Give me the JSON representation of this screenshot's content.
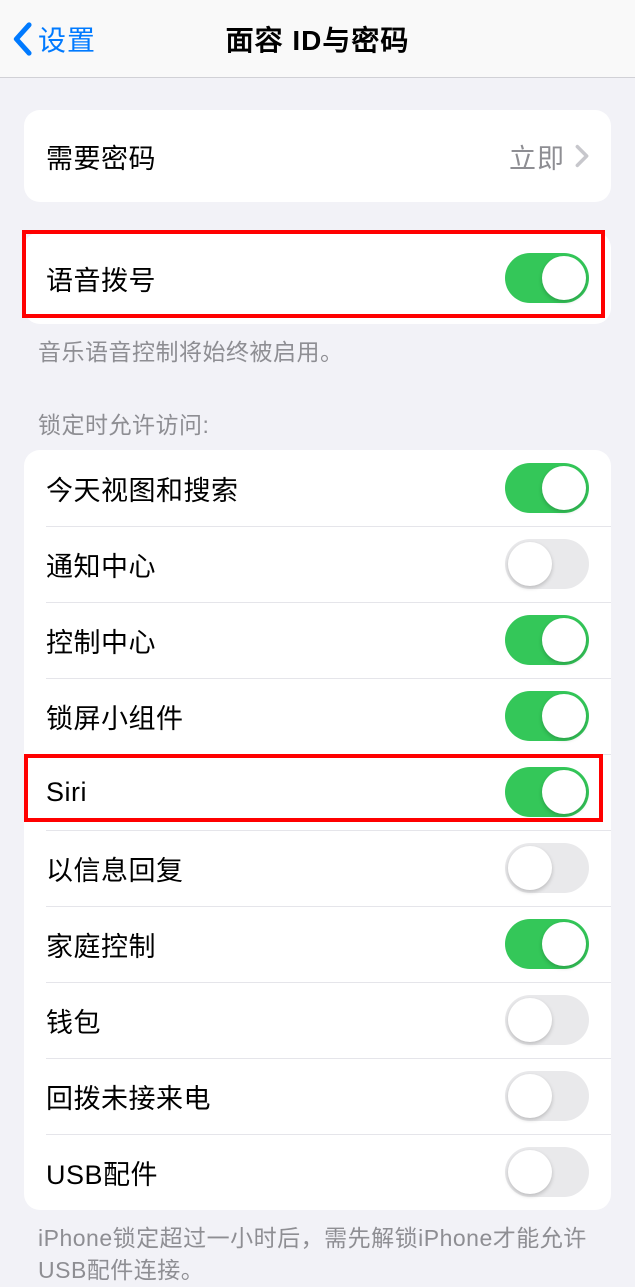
{
  "nav": {
    "back_label": "设置",
    "title": "面容 ID与密码"
  },
  "require_passcode": {
    "label": "需要密码",
    "value": "立即"
  },
  "voice_dial": {
    "label": "语音拨号",
    "on": true,
    "footer": "音乐语音控制将始终被启用。"
  },
  "lock_header": "锁定时允许访问:",
  "lock_items": [
    {
      "label": "今天视图和搜索",
      "on": true
    },
    {
      "label": "通知中心",
      "on": false
    },
    {
      "label": "控制中心",
      "on": true
    },
    {
      "label": "锁屏小组件",
      "on": true
    },
    {
      "label": "Siri",
      "on": true
    },
    {
      "label": "以信息回复",
      "on": false
    },
    {
      "label": "家庭控制",
      "on": true
    },
    {
      "label": "钱包",
      "on": false
    },
    {
      "label": "回拨未接来电",
      "on": false
    },
    {
      "label": "USB配件",
      "on": false
    }
  ],
  "usb_footer": "iPhone锁定超过一小时后，需先解锁iPhone才能允许USB配件连接。"
}
